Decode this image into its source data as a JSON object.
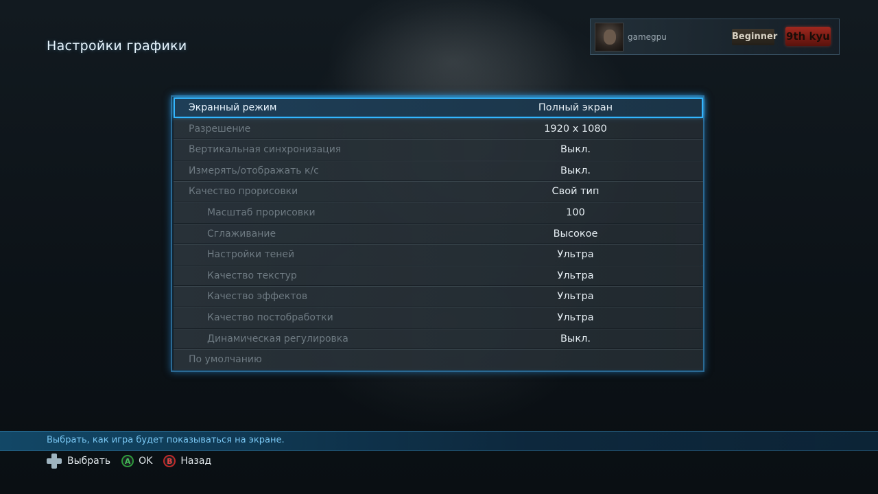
{
  "page_title": "Настройки графики",
  "player": {
    "name": "gamegpu",
    "rank": "Beginner",
    "kyu": "9th kyu"
  },
  "settings": [
    {
      "label": "Экранный режим",
      "value": "Полный экран",
      "selected": true,
      "sub": false
    },
    {
      "label": "Разрешение",
      "value": "1920 x 1080",
      "selected": false,
      "sub": false
    },
    {
      "label": "Вертикальная синхронизация",
      "value": "Выкл.",
      "selected": false,
      "sub": false
    },
    {
      "label": "Измерять/отображать к/с",
      "value": "Выкл.",
      "selected": false,
      "sub": false
    },
    {
      "label": "Качество прорисовки",
      "value": "Свой тип",
      "selected": false,
      "sub": false
    },
    {
      "label": "Масштаб прорисовки",
      "value": "100",
      "selected": false,
      "sub": true
    },
    {
      "label": "Сглаживание",
      "value": "Высокое",
      "selected": false,
      "sub": true
    },
    {
      "label": "Настройки теней",
      "value": "Ультра",
      "selected": false,
      "sub": true
    },
    {
      "label": "Качество текстур",
      "value": "Ультра",
      "selected": false,
      "sub": true
    },
    {
      "label": "Качество эффектов",
      "value": "Ультра",
      "selected": false,
      "sub": true
    },
    {
      "label": "Качество постобработки",
      "value": "Ультра",
      "selected": false,
      "sub": true
    },
    {
      "label": "Динамическая регулировка",
      "value": "Выкл.",
      "selected": false,
      "sub": true
    },
    {
      "label": "По умолчанию",
      "value": "",
      "selected": false,
      "sub": false
    }
  ],
  "help_text": "Выбрать, как игра будет показываться на экране.",
  "controls": {
    "select": {
      "icon": "dpad-icon",
      "label": "Выбрать"
    },
    "ok": {
      "icon": "a-button-icon",
      "glyph": "A",
      "label": "OK"
    },
    "back": {
      "icon": "b-button-icon",
      "glyph": "B",
      "label": "Назад"
    }
  },
  "colors": {
    "accent": "#33b6ff",
    "help_text": "#79c6f2",
    "a_button": "#2e9a3c",
    "b_button": "#c02a2a"
  }
}
